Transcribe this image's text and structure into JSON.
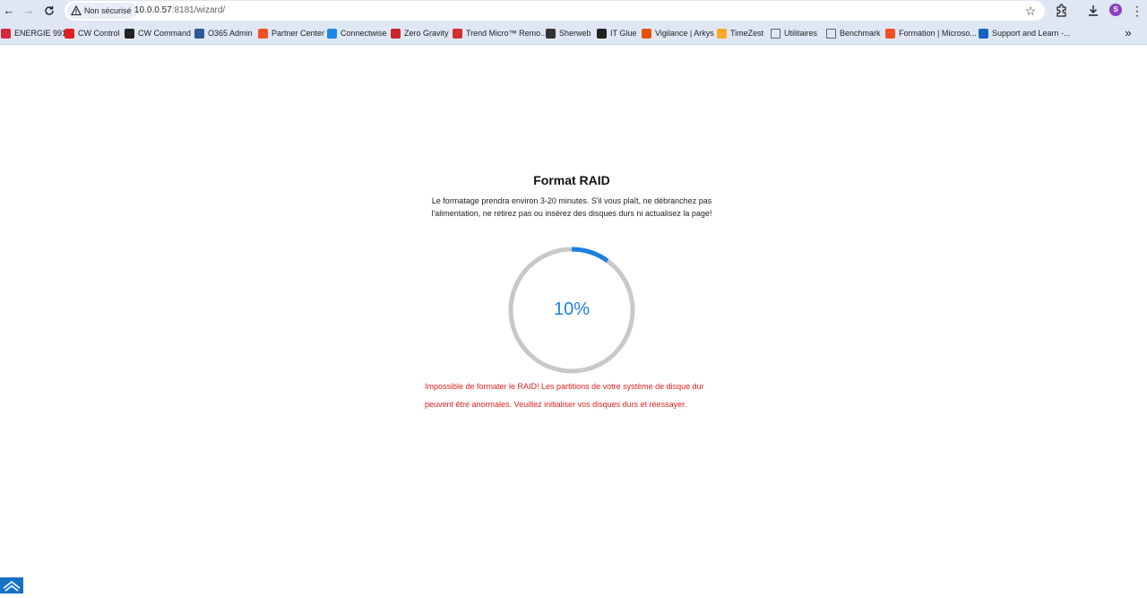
{
  "browser": {
    "security_label": "Non sécurisé",
    "url_host": "10.0.0.57",
    "url_rest": ":8181/wizard/",
    "profile_initial": "S",
    "icons": [
      "back-arrow-icon",
      "forward-arrow-icon",
      "reload-icon",
      "warning-icon",
      "star-icon",
      "extensions-icon",
      "download-icon",
      "kebab-menu-icon"
    ]
  },
  "bookmarks": [
    {
      "label": "ENERGIE 991",
      "color": "#d7263d"
    },
    {
      "label": "CW Control",
      "color": "#e02020"
    },
    {
      "label": "CW Command",
      "color": "#222222"
    },
    {
      "label": "O365 Admin",
      "color": "#2b5797"
    },
    {
      "label": "Partner Center",
      "color": "#f25022"
    },
    {
      "label": "Connectwise",
      "color": "#1e88e5"
    },
    {
      "label": "Zero Gravity",
      "color": "#c62828"
    },
    {
      "label": "Trend Micro™ Remo...",
      "color": "#d32f2f"
    },
    {
      "label": "Sherweb",
      "color": "#333333"
    },
    {
      "label": "IT Glue",
      "color": "#222222"
    },
    {
      "label": "Vigilance | Arkys",
      "color": "#e65100"
    },
    {
      "label": "TimeZest",
      "color": "#f9a825"
    },
    {
      "label": "Utilitaires",
      "color": "#5f6368"
    },
    {
      "label": "Benchmark",
      "color": "#5f6368"
    },
    {
      "label": "Formation | Microso...",
      "color": "#f25022"
    },
    {
      "label": "Support and Learn -...",
      "color": "#1565c0"
    }
  ],
  "bookmarks_overflow": "»",
  "wizard": {
    "title": "Format RAID",
    "description": "Le formatage prendra environ 3-20 minutes. S'il vous plaît, ne débranchez pas l'alimentation, ne retirez pas ou insérez des disques durs ni actualisez la page!",
    "progress": 10,
    "progress_label": "10%",
    "progress_color": "#1e7fe0",
    "track_color": "#c8c8c8",
    "error": "Impossible de formater le RAID! Les partitions de votre système de disque dur peuvent être anormales. Veuillez initialiser vos disques durs et réessayer.",
    "error_color": "#e02020"
  }
}
